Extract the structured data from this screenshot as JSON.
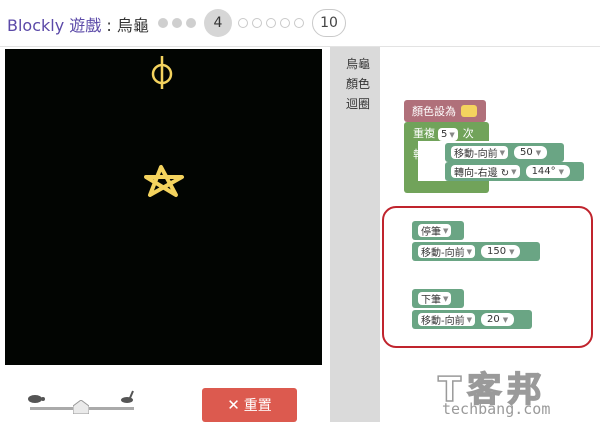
{
  "header": {
    "brand": "Blockly",
    "game": "遊戲",
    "separator": " : ",
    "app_name": "烏龜",
    "current_level": "4",
    "max_level": "10"
  },
  "controls": {
    "reset_label": "重置",
    "reset_icon": "x-icon",
    "speed_slider_value": 0.5
  },
  "toolbox": {
    "categories": [
      "烏龜",
      "顏色",
      "迴圈"
    ]
  },
  "workspace": {
    "set_color_label": "顏色設為",
    "set_color_value": "#f4d35e",
    "repeat_label": "重複",
    "repeat_count": "5",
    "repeat_suffix": "次",
    "do_label": "執行",
    "move_forward": "移動-向前",
    "move_forward_value1": "50",
    "turn_label": "轉向-右邊 ↻",
    "turn_value": "144°",
    "pen_up": "停筆",
    "move_forward_value2": "150",
    "pen_down": "下筆",
    "move_forward_value3": "20"
  },
  "colors": {
    "accent": "#5b49a8",
    "canvas_bg": "#020502",
    "drawing": "#f4d35e",
    "reset_button": "#dc5a4f",
    "block_turtle": "#6aa584",
    "block_loop": "#71a35a",
    "block_color": "#b0707a",
    "highlight_outline": "#c0242d"
  },
  "watermark": {
    "cn": "T客邦",
    "en": "techbang.com"
  }
}
